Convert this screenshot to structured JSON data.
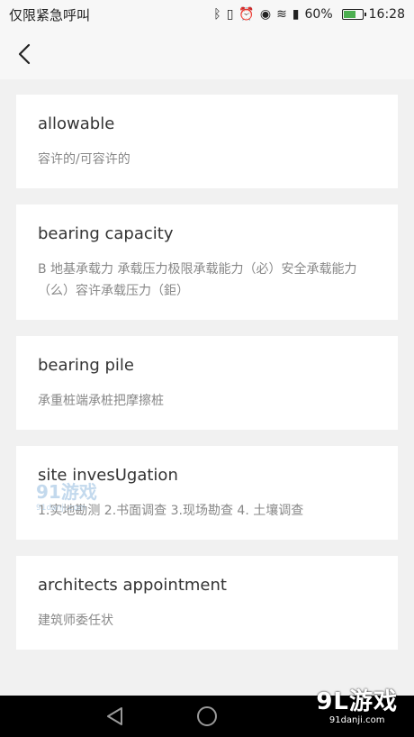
{
  "status": {
    "carrier": "仅限紧急呼叫",
    "battery": "60%",
    "time": "16:28",
    "icons": [
      "bluetooth-icon",
      "vibrate-icon",
      "alarm-icon",
      "eye-icon",
      "wifi-icon",
      "sim-icon",
      "battery-icon"
    ]
  },
  "header": {
    "back_icon": "chevron-left-icon"
  },
  "entries": [
    {
      "term": "allowable",
      "definition": "容许的/可容许的"
    },
    {
      "term": "bearing capacity",
      "definition": "B 地基承载力 承载压力极限承载能力（必）安全承载能力（么）容许承载压力（鉅）"
    },
    {
      "term": "bearing pile",
      "definition": "承重桩端承桩把摩擦桩"
    },
    {
      "term": "site invesUgation",
      "definition": "1.实地勘测 2.书面调查 3.现场勘查 4. 土壤调查"
    },
    {
      "term": "architects appointment",
      "definition": "建筑师委任状"
    }
  ],
  "watermark": {
    "text": "91游戏",
    "url": "91danji.com"
  },
  "brand": {
    "logo": "9L游戏",
    "url": "91danji.com"
  }
}
